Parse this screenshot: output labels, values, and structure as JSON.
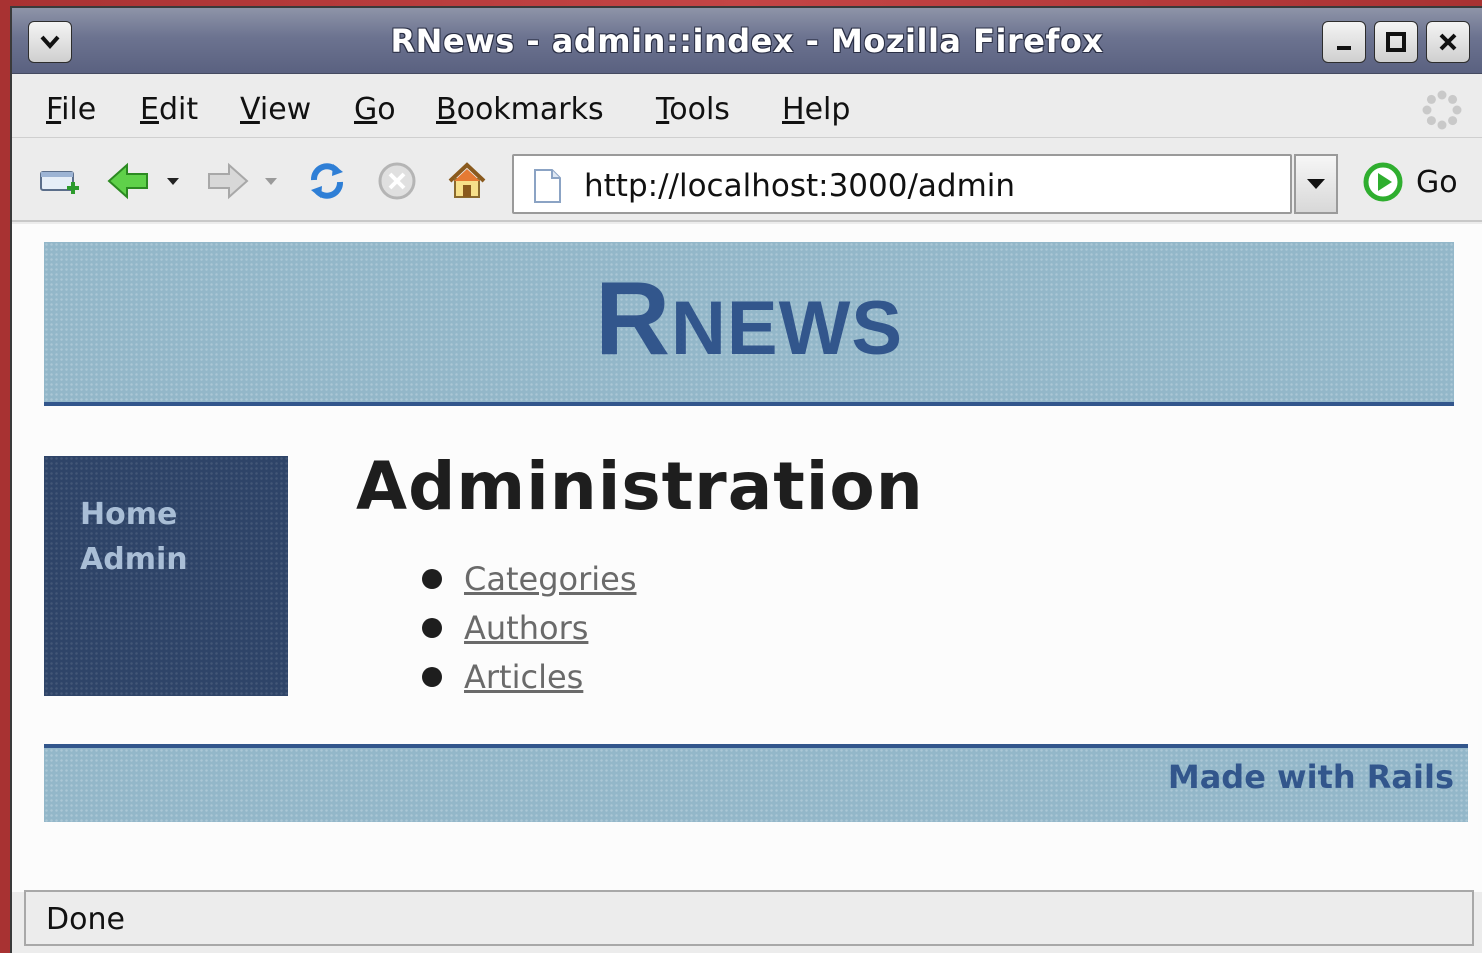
{
  "window": {
    "title": "RNews - admin::index - Mozilla Firefox"
  },
  "menubar": {
    "items": [
      {
        "label": "File",
        "mnemonic": "F",
        "rest": "ile"
      },
      {
        "label": "Edit",
        "mnemonic": "E",
        "rest": "dit"
      },
      {
        "label": "View",
        "mnemonic": "V",
        "rest": "iew"
      },
      {
        "label": "Go",
        "mnemonic": "G",
        "rest": "o"
      },
      {
        "label": "Bookmarks",
        "mnemonic": "B",
        "rest": "ookmarks"
      },
      {
        "label": "Tools",
        "mnemonic": "T",
        "rest": "ools"
      },
      {
        "label": "Help",
        "mnemonic": "H",
        "rest": "elp"
      }
    ]
  },
  "navbar": {
    "url": "http://localhost:3000/admin",
    "go_label": "Go",
    "icons": [
      "new-tab-icon",
      "back-arrow-icon",
      "forward-arrow-icon",
      "reload-icon",
      "stop-icon",
      "home-icon"
    ]
  },
  "page": {
    "banner_first": "R",
    "banner_rest": "NEWS",
    "sidebar": {
      "links": [
        "Home",
        "Admin"
      ]
    },
    "heading": "Administration",
    "admin_links": [
      "Categories",
      "Authors",
      "Articles"
    ],
    "footer": "Made with Rails"
  },
  "statusbar": {
    "text": "Done"
  },
  "colors": {
    "banner_bg": "#93b7c9",
    "banner_accent": "#32568c",
    "sidebar_bg": "#2e4468",
    "sidebar_link": "#a9bed6",
    "link": "#6a6a6a",
    "titlebar": "#6c7390"
  }
}
